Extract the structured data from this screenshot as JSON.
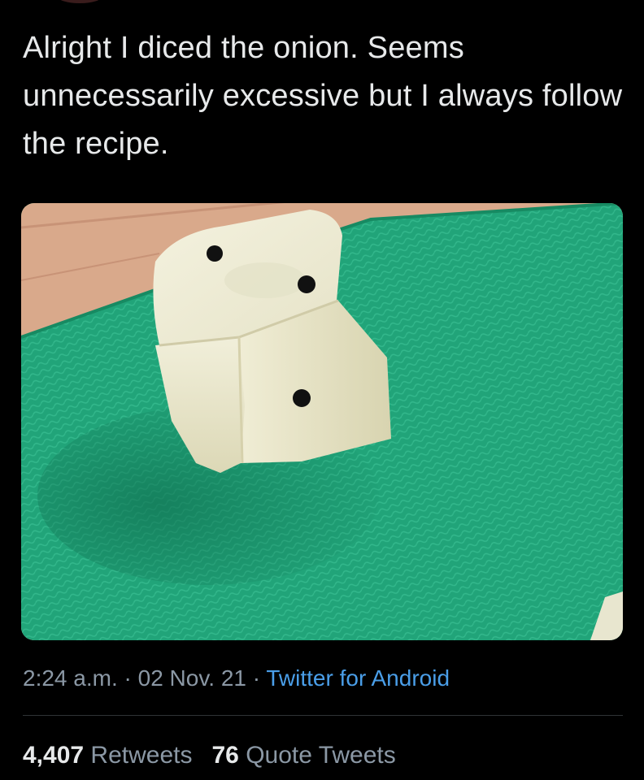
{
  "tweet": {
    "text": "Alright I diced the onion. Seems unnecessarily excessive but I always follow the recipe."
  },
  "media": {
    "icon": "onion-dice-photo",
    "pips": 3,
    "colors": {
      "board": "#1fa075",
      "table": "#d9a98b",
      "onion": "#eeebd4",
      "pip": "#111111"
    }
  },
  "meta": {
    "time": "2:24 a.m.",
    "separator": "·",
    "date": "02 Nov. 21",
    "source": "Twitter for Android"
  },
  "stats": {
    "retweets_count": "4,407",
    "retweets_label": "Retweets",
    "quotes_count": "76",
    "quotes_label": "Quote Tweets"
  },
  "colors": {
    "background": "#000000",
    "text": "#e7e9ea",
    "muted": "#8b98a5",
    "link": "#4a9ee8"
  }
}
